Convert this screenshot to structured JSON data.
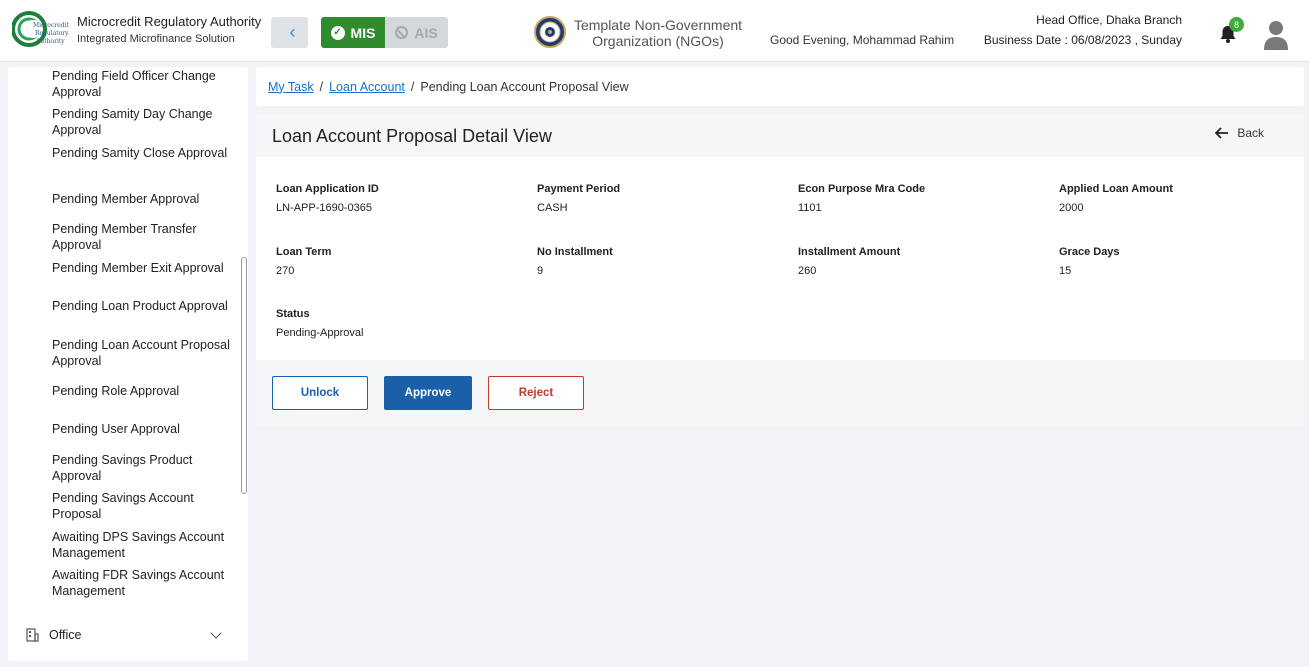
{
  "header": {
    "org_title": "Microcredit Regulatory Authority",
    "org_subtitle": "Integrated Microfinance Solution",
    "logo_text": "Microcredit Regulatory Authority",
    "mis_label": "MIS",
    "ais_label": "AIS",
    "ngo_line1": "Template Non-Government",
    "ngo_line2": "Organization (NGOs)",
    "greeting": "Good Evening, Mohammad Rahim",
    "branch": "Head Office, Dhaka Branch",
    "business_date": "Business Date : 06/08/2023 , Sunday",
    "notification_count": "8",
    "accent": "#2e8b2e"
  },
  "sidebar": {
    "items": [
      {
        "label": "Pending Field Officer Change Approval"
      },
      {
        "label": "Pending Samity Day Change Approval"
      },
      {
        "label": "Pending Samity Close Approval"
      },
      {
        "label": "Pending Member Approval"
      },
      {
        "label": "Pending Member Transfer Approval"
      },
      {
        "label": "Pending Member Exit Approval"
      },
      {
        "label": "Pending Loan Product Approval"
      },
      {
        "label": "Pending Loan Account Proposal Approval"
      },
      {
        "label": "Pending Role Approval"
      },
      {
        "label": "Pending User Approval"
      },
      {
        "label": "Pending Savings Product Approval"
      },
      {
        "label": "Pending Savings Account Proposal"
      },
      {
        "label": "Awaiting DPS Savings Account Management"
      },
      {
        "label": "Awaiting FDR Savings Account Management"
      }
    ],
    "office_label": "Office"
  },
  "breadcrumb": {
    "items": [
      "My Task",
      "Loan Account"
    ],
    "current": "Pending Loan Account Proposal View"
  },
  "detail": {
    "title": "Loan Account Proposal Detail View",
    "back_label": "Back",
    "fields": [
      {
        "label": "Loan Application ID",
        "value": "LN-APP-1690-0365"
      },
      {
        "label": "Payment Period",
        "value": "CASH"
      },
      {
        "label": "Econ Purpose Mra Code",
        "value": "1101"
      },
      {
        "label": "Applied Loan Amount",
        "value": "2000"
      },
      {
        "label": "Loan Term",
        "value": "270"
      },
      {
        "label": "No Installment",
        "value": "9"
      },
      {
        "label": "Installment Amount",
        "value": "260"
      },
      {
        "label": "Grace Days",
        "value": "15"
      },
      {
        "label": "Status",
        "value": "Pending-Approval"
      }
    ],
    "actions": {
      "unlock": "Unlock",
      "approve": "Approve",
      "reject": "Reject"
    }
  }
}
